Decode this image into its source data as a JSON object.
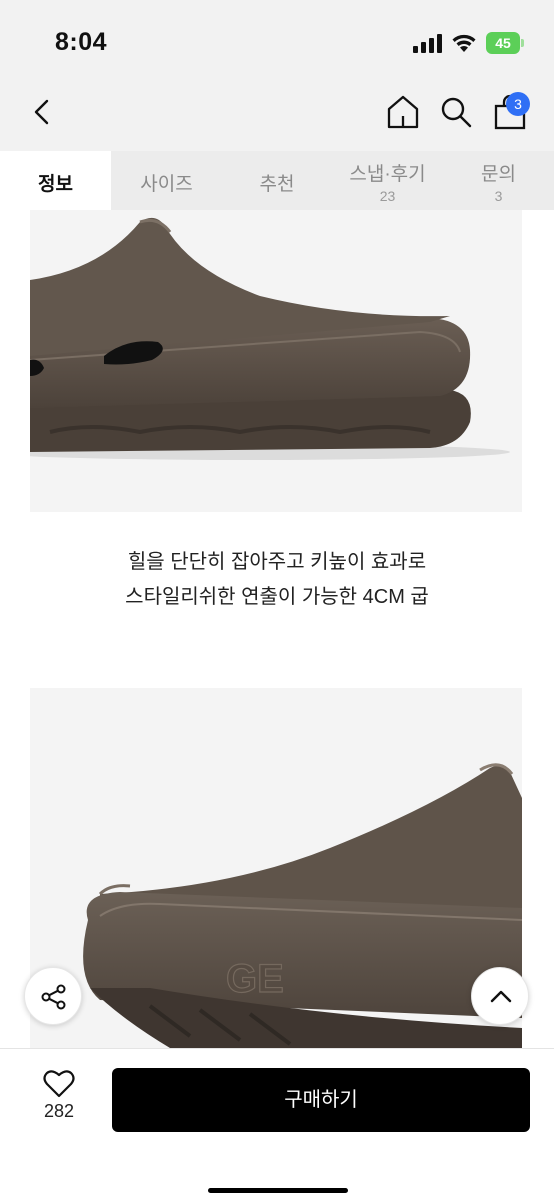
{
  "status_bar": {
    "time": "8:04",
    "battery": "45"
  },
  "header": {
    "icons": [
      "back-chevron-icon",
      "home-icon",
      "search-icon",
      "shopping-bag-icon"
    ],
    "cart_badge": "3"
  },
  "tabs": [
    {
      "label": "정보",
      "count": "",
      "active": true
    },
    {
      "label": "사이즈",
      "count": ""
    },
    {
      "label": "추천",
      "count": ""
    },
    {
      "label": "스냅·후기",
      "count": "23"
    },
    {
      "label": "문의",
      "count": "3"
    }
  ],
  "content": {
    "description_line1": "힐을 단단히 잡아주고 키높이 효과로",
    "description_line2": "스타일리쉬한 연출이 가능한 4CM 굽"
  },
  "bottom_bar": {
    "like_count": "282",
    "buy_label": "구매하기"
  },
  "colors": {
    "accent_badge": "#2f6ff5",
    "buy_button": "#000000",
    "product_brown": "#5b5046"
  }
}
